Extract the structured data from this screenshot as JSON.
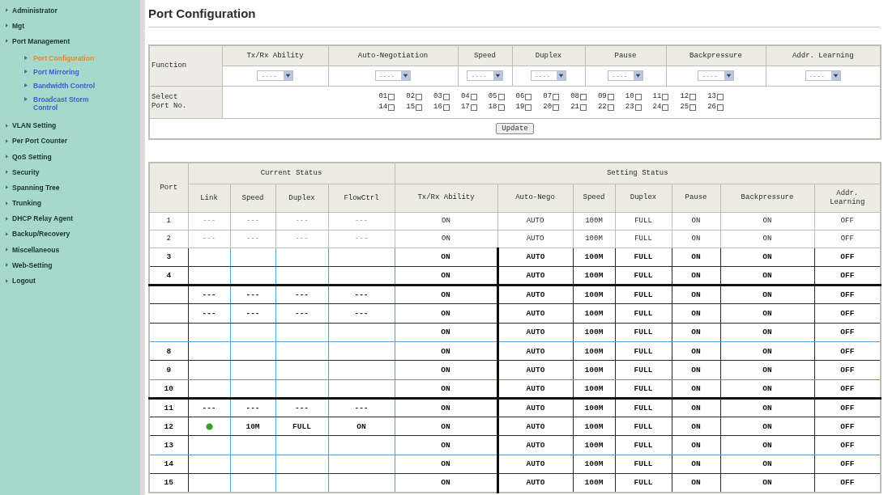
{
  "sidebar": {
    "items": [
      {
        "label": "Administrator"
      },
      {
        "label": "Mgt"
      },
      {
        "label": "Port Management",
        "children": [
          {
            "label": "Port Configuration",
            "selected": true
          },
          {
            "label": "Port Mirroring",
            "selected": false
          },
          {
            "label": "Bandwidth Control",
            "selected": false
          },
          {
            "label": "Broadcast Storm Control",
            "selected": false
          }
        ]
      },
      {
        "label": "VLAN Setting"
      },
      {
        "label": "Per Port Counter"
      },
      {
        "label": "QoS Setting"
      },
      {
        "label": "Security"
      },
      {
        "label": "Spanning Tree"
      },
      {
        "label": "Trunking"
      },
      {
        "label": "DHCP Relay Agent"
      },
      {
        "label": "Backup/Recovery"
      },
      {
        "label": "Miscellaneous"
      },
      {
        "label": "Web-Setting"
      },
      {
        "label": "Logout"
      }
    ]
  },
  "title": "Port Configuration",
  "function_table": {
    "row_label": "Function",
    "columns": [
      {
        "heading": "Tx/Rx Ability",
        "value": "----"
      },
      {
        "heading": "Auto-Negotiation",
        "value": "----"
      },
      {
        "heading": "Speed",
        "value": "----"
      },
      {
        "heading": "Duplex",
        "value": "----"
      },
      {
        "heading": "Pause",
        "value": "----"
      },
      {
        "heading": "Backpressure",
        "value": "----"
      },
      {
        "heading": "Addr. Learning",
        "value": "----"
      }
    ],
    "port_select": {
      "label": "Select Port No.",
      "ports": [
        {
          "number": "01",
          "checked": false
        },
        {
          "number": "02",
          "checked": false
        },
        {
          "number": "03",
          "checked": false
        },
        {
          "number": "04",
          "checked": false
        },
        {
          "number": "05",
          "checked": false
        },
        {
          "number": "06",
          "checked": false
        },
        {
          "number": "07",
          "checked": false
        },
        {
          "number": "08",
          "checked": false
        },
        {
          "number": "09",
          "checked": false
        },
        {
          "number": "10",
          "checked": false
        },
        {
          "number": "11",
          "checked": false
        },
        {
          "number": "12",
          "checked": false
        },
        {
          "number": "13",
          "checked": false
        },
        {
          "number": "14",
          "checked": false
        },
        {
          "number": "15",
          "checked": false
        },
        {
          "number": "16",
          "checked": false
        },
        {
          "number": "17",
          "checked": false
        },
        {
          "number": "18",
          "checked": false
        },
        {
          "number": "19",
          "checked": false
        },
        {
          "number": "20",
          "checked": false
        },
        {
          "number": "21",
          "checked": false
        },
        {
          "number": "22",
          "checked": false
        },
        {
          "number": "23",
          "checked": false
        },
        {
          "number": "24",
          "checked": false
        },
        {
          "number": "25",
          "checked": false
        },
        {
          "number": "26",
          "checked": false
        }
      ]
    },
    "button": "Update"
  },
  "status_table": {
    "port_heading": "Port",
    "current_heading": "Current Status",
    "current_columns": [
      "Link",
      "Speed",
      "Duplex",
      "FlowCtrl"
    ],
    "setting_heading": "Setting Status",
    "setting_columns": [
      "Tx/Rx Ability",
      "Auto-Nego",
      "Speed",
      "Duplex",
      "Pause",
      "Backpressure",
      "Addr. Learning"
    ],
    "rows": [
      {
        "port": "1",
        "link_up": false,
        "link": "---",
        "speed": "---",
        "duplex": "---",
        "flow_ctrl": "---",
        "settings": [
          "ON",
          "AUTO",
          "100M",
          "FULL",
          "ON",
          "ON",
          "OFF"
        ]
      },
      {
        "port": "2",
        "link_up": false,
        "link": "---",
        "speed": "---",
        "duplex": "---",
        "flow_ctrl": "---",
        "settings": [
          "ON",
          "AUTO",
          "100M",
          "FULL",
          "ON",
          "ON",
          "OFF"
        ]
      },
      {
        "port": "3",
        "link_up": false,
        "settings": [
          "ON",
          "AUTO",
          "100M",
          "FULL",
          "ON",
          "ON",
          "OFF"
        ]
      },
      {
        "port": "4",
        "link_up": false,
        "settings": [
          "ON",
          "AUTO",
          "100M",
          "FULL",
          "ON",
          "ON",
          "OFF"
        ]
      },
      {
        "link_up": false,
        "link": "---",
        "speed": "---",
        "duplex": "---",
        "flow_ctrl": "---",
        "settings": [
          "ON",
          "AUTO",
          "100M",
          "FULL",
          "ON",
          "ON",
          "OFF"
        ]
      },
      {
        "link_up": false,
        "link": "---",
        "speed": "---",
        "duplex": "---",
        "flow_ctrl": "---",
        "settings": [
          "ON",
          "AUTO",
          "100M",
          "FULL",
          "ON",
          "ON",
          "OFF"
        ]
      },
      {
        "link_up": false,
        "settings": [
          "ON",
          "AUTO",
          "100M",
          "FULL",
          "ON",
          "ON",
          "OFF"
        ]
      },
      {
        "port": "8",
        "link_up": false,
        "settings": [
          "ON",
          "AUTO",
          "100M",
          "FULL",
          "ON",
          "ON",
          "OFF"
        ]
      },
      {
        "port": "9",
        "link_up": false,
        "settings": [
          "ON",
          "AUTO",
          "100M",
          "FULL",
          "ON",
          "ON",
          "OFF"
        ]
      },
      {
        "port": "10",
        "link_up": false,
        "settings": [
          "ON",
          "AUTO",
          "100M",
          "FULL",
          "ON",
          "ON",
          "OFF"
        ]
      },
      {
        "port": "11",
        "link_up": false,
        "link": "---",
        "speed": "---",
        "duplex": "---",
        "flow_ctrl": "---",
        "settings": [
          "ON",
          "AUTO",
          "100M",
          "FULL",
          "ON",
          "ON",
          "OFF"
        ]
      },
      {
        "port": "12",
        "link_up": true,
        "speed": "10M",
        "duplex": "FULL",
        "flow_ctrl": "ON",
        "settings": [
          "ON",
          "AUTO",
          "100M",
          "FULL",
          "ON",
          "ON",
          "OFF"
        ]
      },
      {
        "port": "13",
        "link_up": false,
        "settings": [
          "ON",
          "AUTO",
          "100M",
          "FULL",
          "ON",
          "ON",
          "OFF"
        ]
      },
      {
        "port": "14",
        "link_up": false,
        "settings": [
          "ON",
          "AUTO",
          "100M",
          "FULL",
          "ON",
          "ON",
          "OFF"
        ]
      },
      {
        "port": "15",
        "link_up": false,
        "settings": [
          "ON",
          "AUTO",
          "100M",
          "FULL",
          "ON",
          "ON",
          "OFF"
        ]
      }
    ]
  }
}
